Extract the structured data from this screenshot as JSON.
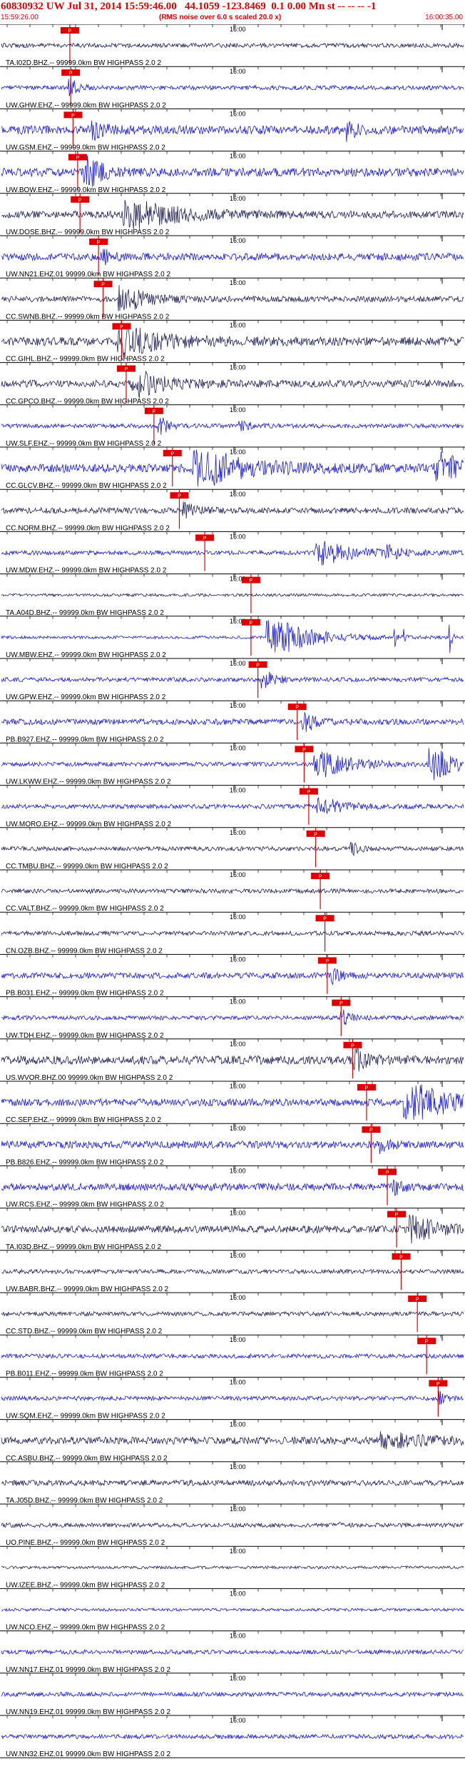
{
  "header": {
    "title": "60830932 UW Jul 31, 2014 15:59:46.00   44.1059 -123.8469  0.1 0.00 Mn st -- -- -- -1",
    "start_time": "15:59:26.00",
    "end_time": "16:00:35.00",
    "rms_note": "(RMS noise over 6.0 s scaled 20.0 x)"
  },
  "colors": {
    "header_text": "#e00000",
    "trace_a": "#1a1ae6",
    "trace_b": "#22225a",
    "pick_box": "#e00000",
    "pick_line": "#e00000",
    "axis": "#000000",
    "label": "#000000"
  },
  "chart_data": {
    "type": "line",
    "title": "60830932 UW Jul 31, 2014 15:59:46.00",
    "time_start": "15:59:26.00",
    "time_end": "16:00:35.00",
    "tick_label": "16:00",
    "pick_label": "P",
    "traces": [
      {
        "label": "TA.I02D.BHZ.-- 99999.0km BW  HIGHPASS  2.0  2",
        "color": "b",
        "amp": 3,
        "pick": 0.148,
        "events": []
      },
      {
        "label": "UW.GHW.EHZ.-- 99999.0km BW  HIGHPASS  2.0  2",
        "color": "a",
        "amp": 3,
        "pick": 0.15,
        "events": [
          {
            "t": 0.15,
            "a": 12,
            "w": 0.02
          }
        ]
      },
      {
        "label": "UW.GSM.EHZ.-- 99999.0km BW  HIGHPASS  2.0  2",
        "color": "a",
        "amp": 6,
        "pick": 0.155,
        "events": [
          {
            "t": 0.2,
            "a": 10,
            "w": 0.03
          },
          {
            "t": 0.75,
            "a": 12,
            "w": 0.02
          }
        ]
      },
      {
        "label": "UW.BOW.EHZ.-- 99999.0km BW  HIGHPASS  2.0  2",
        "color": "a",
        "amp": 6,
        "pick": 0.165,
        "events": [
          {
            "t": 0.19,
            "a": 18,
            "w": 0.04
          }
        ]
      },
      {
        "label": "UW.DOSE.BHZ.-- 99999.0km BW  HIGHPASS  2.0  2",
        "color": "b",
        "amp": 5,
        "pick": 0.17,
        "events": [
          {
            "t": 0.3,
            "a": 16,
            "w": 0.12
          }
        ]
      },
      {
        "label": "UW.NN21.EHZ.01 99999.0km BW  HIGHPASS  2.0  2",
        "color": "a",
        "amp": 5,
        "pick": 0.21,
        "events": [
          {
            "t": 0.22,
            "a": 10,
            "w": 0.02
          }
        ]
      },
      {
        "label": "CC.SWNB.BHZ.-- 99999.0km BW  HIGHPASS  2.0  2",
        "color": "b",
        "amp": 4,
        "pick": 0.22,
        "events": [
          {
            "t": 0.27,
            "a": 16,
            "w": 0.06
          }
        ]
      },
      {
        "label": "CC.GIHL.BHZ.-- 99999.0km BW  HIGHPASS  2.0  2",
        "color": "b",
        "amp": 6,
        "pick": 0.26,
        "events": [
          {
            "t": 0.28,
            "a": 17,
            "w": 0.1
          }
        ]
      },
      {
        "label": "CC.GPCO.BHZ.-- 99999.0km BW  HIGHPASS  2.0  2",
        "color": "b",
        "amp": 5,
        "pick": 0.27,
        "events": [
          {
            "t": 0.3,
            "a": 16,
            "w": 0.07
          }
        ]
      },
      {
        "label": "UW.SLF.EHZ.-- 99999.0km BW  HIGHPASS  2.0  2",
        "color": "a",
        "amp": 3,
        "pick": 0.33,
        "events": [
          {
            "t": 0.345,
            "a": 12,
            "w": 0.02
          },
          {
            "t": 0.52,
            "a": 8,
            "w": 0.02
          }
        ]
      },
      {
        "label": "CC.GLCV.BHZ.-- 99999.0km BW  HIGHPASS  2.0  2",
        "color": "a",
        "amp": 6,
        "pick": 0.37,
        "events": [
          {
            "t": 0.45,
            "a": 22,
            "w": 0.12
          },
          {
            "t": 0.95,
            "a": 24,
            "w": 0.05
          }
        ]
      },
      {
        "label": "CC.NORM.BHZ.-- 99999.0km BW  HIGHPASS  2.0  2",
        "color": "b",
        "amp": 4,
        "pick": 0.385,
        "events": [
          {
            "t": 0.4,
            "a": 9,
            "w": 0.03
          }
        ]
      },
      {
        "label": "UW.MDW.EHZ.-- 99999.0km BW  HIGHPASS  2.0  2",
        "color": "a",
        "amp": 3,
        "pick": 0.44,
        "events": [
          {
            "t": 0.7,
            "a": 15,
            "w": 0.08
          },
          {
            "t": 0.84,
            "a": 8,
            "w": 0.03
          }
        ]
      },
      {
        "label": "TA.A04D.BHZ.-- 99999.0km BW  HIGHPASS  2.0  2",
        "color": "b",
        "amp": 2,
        "pick": 0.54,
        "events": []
      },
      {
        "label": "UW.MBW.EHZ.-- 99999.0km BW  HIGHPASS  2.0  2",
        "color": "a",
        "amp": 2,
        "pick": 0.54,
        "events": [
          {
            "t": 0.6,
            "a": 26,
            "w": 0.09
          },
          {
            "t": 0.85,
            "a": 24,
            "w": 0.005
          },
          {
            "t": 0.87,
            "a": 24,
            "w": 0.005
          },
          {
            "t": 0.97,
            "a": 24,
            "w": 0.005
          }
        ]
      },
      {
        "label": "UW.GPW.EHZ.-- 99999.0km BW  HIGHPASS  2.0  2",
        "color": "a",
        "amp": 3,
        "pick": 0.555,
        "events": [
          {
            "t": 0.57,
            "a": 12,
            "w": 0.03
          }
        ]
      },
      {
        "label": "PB.B927.EHZ.-- 99999.0km BW  HIGHPASS  2.0  2",
        "color": "a",
        "amp": 4,
        "pick": 0.64,
        "events": [
          {
            "t": 0.66,
            "a": 12,
            "w": 0.03
          }
        ]
      },
      {
        "label": "UW.LKWW.EHZ.-- 99999.0km BW  HIGHPASS  2.0  2",
        "color": "a",
        "amp": 3,
        "pick": 0.655,
        "events": [
          {
            "t": 0.7,
            "a": 16,
            "w": 0.08
          },
          {
            "t": 0.94,
            "a": 22,
            "w": 0.05
          }
        ]
      },
      {
        "label": "UW.MORO.EHZ.-- 99999.0km BW  HIGHPASS  2.0  2",
        "color": "a",
        "amp": 3,
        "pick": 0.665,
        "events": [
          {
            "t": 0.7,
            "a": 11,
            "w": 0.06
          }
        ]
      },
      {
        "label": "CC.TMBU.BHZ.-- 99999.0km BW  HIGHPASS  2.0  2",
        "color": "b",
        "amp": 3,
        "pick": 0.68,
        "events": [
          {
            "t": 0.76,
            "a": 9,
            "w": 0.02
          }
        ]
      },
      {
        "label": "CC.VALT.BHZ.-- 99999.0km BW  HIGHPASS  2.0  2",
        "color": "b",
        "amp": 3,
        "pick": 0.69,
        "events": []
      },
      {
        "label": "CN.OZB.BHZ.-- 99999.0km BW  HIGHPASS  2.0  2",
        "color": "b",
        "amp": 3,
        "pick": 0.7,
        "events": []
      },
      {
        "label": "PB.B031.EHZ.-- 99999.0km BW  HIGHPASS  2.0  2",
        "color": "a",
        "amp": 4,
        "pick": 0.705,
        "events": [
          {
            "t": 0.72,
            "a": 10,
            "w": 0.02
          }
        ]
      },
      {
        "label": "UW.TDH.EHZ.-- 99999.0km BW  HIGHPASS  2.0  2",
        "color": "a",
        "amp": 3,
        "pick": 0.735,
        "events": [
          {
            "t": 0.74,
            "a": 10,
            "w": 0.02
          }
        ]
      },
      {
        "label": "US.WVOR.BHZ.00 99999.0km BW  HIGHPASS  2.0  2",
        "color": "b",
        "amp": 6,
        "pick": 0.76,
        "events": [
          {
            "t": 0.77,
            "a": 12,
            "w": 0.03
          }
        ]
      },
      {
        "label": "CC.SEP.EHZ.-- 99999.0km BW  HIGHPASS  2.0  2",
        "color": "a",
        "amp": 5,
        "pick": 0.79,
        "events": [
          {
            "t": 0.9,
            "a": 24,
            "w": 0.1
          }
        ]
      },
      {
        "label": "PB.B826.EHZ.-- 99999.0km BW  HIGHPASS  2.0  2",
        "color": "a",
        "amp": 5,
        "pick": 0.8,
        "events": [
          {
            "t": 0.82,
            "a": 9,
            "w": 0.02
          }
        ]
      },
      {
        "label": "UW.RCS.EHZ.-- 99999.0km BW  HIGHPASS  2.0  2",
        "color": "a",
        "amp": 5,
        "pick": 0.835,
        "events": [
          {
            "t": 0.85,
            "a": 10,
            "w": 0.02
          }
        ]
      },
      {
        "label": "TA.I03D.BHZ.-- 99999.0km BW  HIGHPASS  2.0  2",
        "color": "b",
        "amp": 5,
        "pick": 0.855,
        "events": [
          {
            "t": 0.9,
            "a": 16,
            "w": 0.06
          }
        ]
      },
      {
        "label": "UW.BABR.BHZ.-- 99999.0km BW  HIGHPASS  2.0  2",
        "color": "b",
        "amp": 3,
        "pick": 0.865,
        "events": []
      },
      {
        "label": "CC.STD.BHZ.-- 99999.0km BW  HIGHPASS  2.0  2",
        "color": "b",
        "amp": 3,
        "pick": 0.9,
        "events": []
      },
      {
        "label": "PB.B011.EHZ.-- 99999.0km BW  HIGHPASS  2.0  2",
        "color": "a",
        "amp": 3,
        "pick": 0.92,
        "events": []
      },
      {
        "label": "UW.SQM.EHZ.-- 99999.0km BW  HIGHPASS  2.0  2",
        "color": "a",
        "amp": 3,
        "pick": 0.945,
        "events": [
          {
            "t": 0.95,
            "a": 8,
            "w": 0.02
          }
        ]
      },
      {
        "label": "CC.ASBU.BHZ.-- 99999.0km BW  HIGHPASS  2.0  2",
        "color": "b",
        "amp": 5,
        "pick": null,
        "events": [
          {
            "t": 0.85,
            "a": 8,
            "w": 0.1
          }
        ]
      },
      {
        "label": "TA.J05D.BHZ.-- 99999.0km BW  HIGHPASS  2.0  2",
        "color": "b",
        "amp": 4,
        "pick": null,
        "events": []
      },
      {
        "label": "UO.PINE.BHZ.-- 99999.0km BW  HIGHPASS  2.0  2",
        "color": "b",
        "amp": 3,
        "pick": null,
        "events": [
          {
            "t": 0.73,
            "a": 6,
            "w": 0.01
          }
        ]
      },
      {
        "label": "UW.IZEE.BHZ.-- 99999.0km BW  HIGHPASS  2.0  2",
        "color": "b",
        "amp": 2,
        "pick": null,
        "events": []
      },
      {
        "label": "UW.NCO.EHZ.-- 99999.0km BW  HIGHPASS  2.0  2",
        "color": "a",
        "amp": 2,
        "pick": null,
        "events": []
      },
      {
        "label": "UW.NN17.EHZ.01 99999.0km BW  HIGHPASS  2.0  2",
        "color": "a",
        "amp": 3,
        "pick": null,
        "events": []
      },
      {
        "label": "UW.NN19.EHZ.01 99999.0km BW  HIGHPASS  2.0  2",
        "color": "a",
        "amp": 3,
        "pick": null,
        "events": []
      },
      {
        "label": "UW.NN32.EHZ.01 99999.0km BW  HIGHPASS  2.0  2",
        "color": "a",
        "amp": 3,
        "pick": null,
        "events": []
      }
    ]
  }
}
